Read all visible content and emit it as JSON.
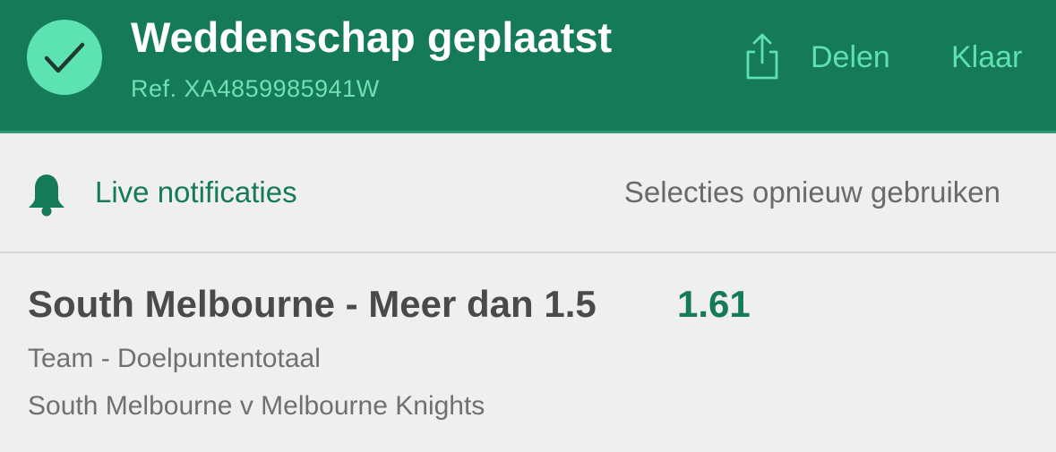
{
  "header": {
    "title": "Weddenschap geplaatst",
    "ref": "Ref. XA4859985941W",
    "share_label": "Delen",
    "done_label": "Klaar",
    "icons": [
      "check-icon",
      "share-icon"
    ],
    "background_color": "#157a58",
    "accent_color": "#5fe0b0"
  },
  "actions": {
    "live_label": "Live notificaties",
    "reuse_label": "Selecties opnieuw gebruiken",
    "icon": "bell-icon"
  },
  "selection": {
    "title": "South Melbourne - Meer dan 1.5",
    "odds": "1.61",
    "market": "Team - Doelpuntentotaal",
    "event": "South Melbourne v Melbourne Knights"
  }
}
